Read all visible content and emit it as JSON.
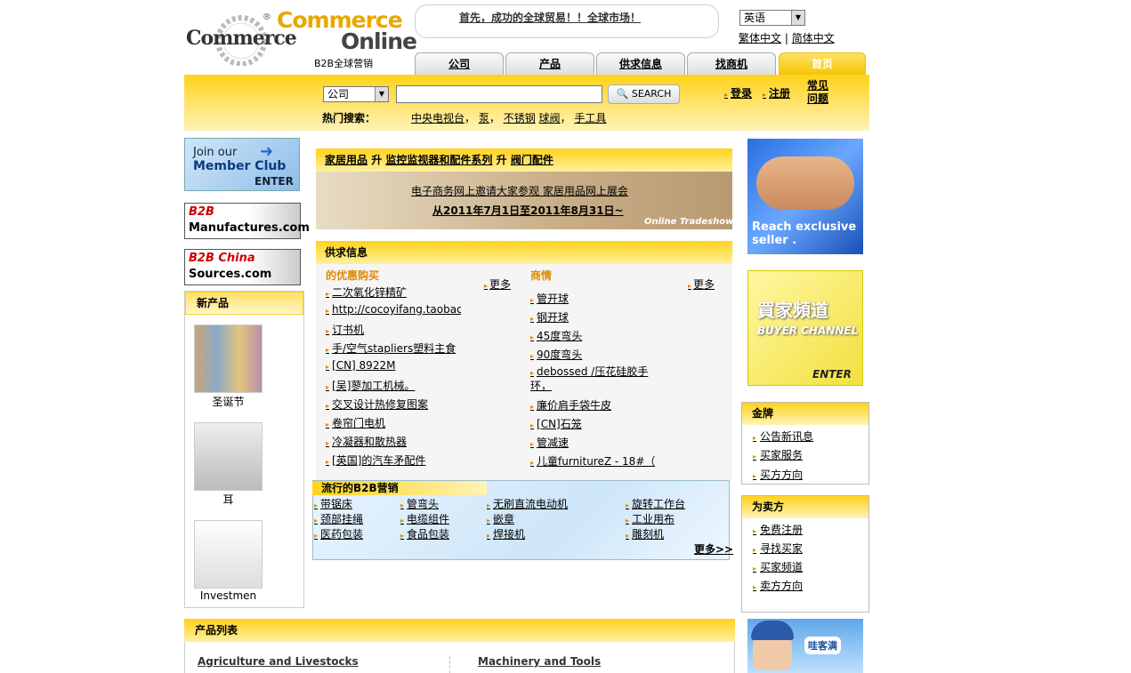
{
  "header": {
    "logo_ring_text": "Commerce",
    "logo_word1": "Commerce",
    "logo_word2": "Online",
    "tagline": "B2B全球营销",
    "bubble_text": "首先，成功的全球贸易！！全球市场！",
    "language_selected": "英语",
    "lang_traditional": "繁体中文",
    "lang_simplified": "简体中文"
  },
  "tabs": [
    {
      "label": "公司"
    },
    {
      "label": "产品"
    },
    {
      "label": "供求信息"
    },
    {
      "label": "找商机"
    },
    {
      "label": "首页"
    }
  ],
  "search": {
    "category_selected": "公司",
    "input_value": "",
    "button_label": "SEARCH",
    "login": "登录",
    "register": "注册",
    "faq_line1": "常见",
    "faq_line2": "问题",
    "hot_label": "热门搜索：",
    "hot_terms": [
      "中央电视台",
      "泵",
      "不锈钢",
      "球阀",
      "手工具"
    ]
  },
  "left": {
    "member_club": {
      "line1": "Join our",
      "line2": "Member Club",
      "enter": "ENTER"
    },
    "manufactures": {
      "b2b": "B2B",
      "text": "Manufactures.com"
    },
    "chinasources": {
      "b2b": "B2B China",
      "text": "Sources.com"
    },
    "new_products_title": "新产品",
    "products": [
      {
        "name": "圣诞节"
      },
      {
        "name": "耳"
      },
      {
        "name": "Investmen"
      }
    ]
  },
  "expo": {
    "crumbs": [
      "家居用品",
      "升",
      "监控监视器和配件系列",
      "升",
      "阀门配件"
    ],
    "line1": "电子商务网上邀请大家参观  家居用品网上展会",
    "line2": "从2011年7月1日至2011年8月31日~",
    "tag": "Online Tradeshow"
  },
  "supply_demand": {
    "title": "供求信息",
    "buy": {
      "title": "的优惠购买",
      "more": "更多",
      "items": [
        "二次氧化锌精矿",
        "http://cocoyifang.taobao.com",
        "订书机",
        "手/空气stapliers塑料主食",
        "[CN] 8922M",
        "[吴]蓼加工机械。",
        "交叉设计热修复图案",
        "卷帘门电机",
        "冷凝器和散热器",
        "[英国]的汽车矛配件"
      ]
    },
    "sell": {
      "title": "商情",
      "more": "更多",
      "items": [
        "管开球",
        "钢开球",
        "45度弯头",
        "90度弯头",
        "debossed /压花硅胶手环，",
        "廉价肩手袋牛皮",
        "[CN]石笼",
        "管减速",
        "儿童furnitureZ - 18#（8"
      ]
    }
  },
  "popular": {
    "title": "流行的B2B营销",
    "items": [
      "带锯床",
      "管弯头",
      "无刷直流电动机",
      "旋转工作台",
      "颈部挂绳",
      "电缆组件",
      "嵌章",
      "工业用布",
      "医药包装",
      "食品包装",
      "焊接机",
      "雕刻机"
    ],
    "more": "更多>>"
  },
  "right": {
    "handshake_text": "Reach exclusive seller .",
    "buyer_channel": {
      "cn": "買家頻道",
      "en": "BUYER CHANNEL",
      "enter": "ENTER"
    },
    "gold": {
      "title": "金牌",
      "links": [
        "公告新讯息",
        "买家服务",
        "买方方向"
      ]
    },
    "seller": {
      "title": "为卖方",
      "links": [
        "免费注册",
        "寻找买家",
        "买家频道",
        "卖方方向"
      ]
    },
    "baby_brand": "哇客满"
  },
  "product_list": {
    "title": "产品列表",
    "categories": [
      "Agriculture and Livestocks",
      "Machinery and Tools"
    ]
  }
}
